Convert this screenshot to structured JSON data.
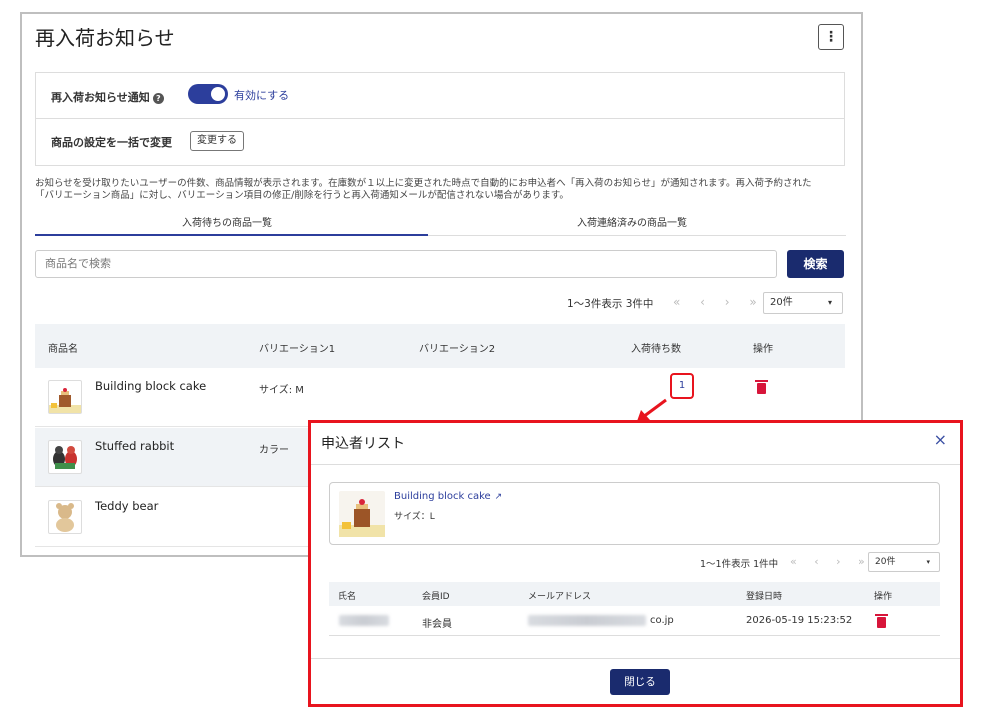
{
  "page": {
    "title": "再入荷お知らせ",
    "menu_icon": "⋮"
  },
  "settings": {
    "notify_label": "再入荷お知らせ通知",
    "help_icon": "?",
    "toggle_label": "有効にする",
    "toggle_on": true,
    "bulk_label": "商品の設定を一括で変更",
    "change_button": "変更する"
  },
  "description": {
    "line1": "お知らせを受け取りたいユーザーの件数、商品情報が表示されます。在庫数が１以上に変更された時点で自動的にお申込者へ「再入荷のお知らせ」が通知されます。再入荷予約された",
    "line2": "「バリエーション商品」に対し、バリエーション項目の修正/削除を行うと再入荷通知メールが配信されない場合があります。"
  },
  "tabs": [
    {
      "label": "入荷待ちの商品一覧",
      "active": true
    },
    {
      "label": "入荷連絡済みの商品一覧",
      "active": false
    }
  ],
  "search": {
    "placeholder": "商品名で検索",
    "button": "検索"
  },
  "pager": {
    "info": "1〜3件表示 3件中",
    "nav": "« ‹ › »",
    "per_page": "20件",
    "caret": "▾"
  },
  "table": {
    "headers": [
      "商品名",
      "バリエーション1",
      "バリエーション2",
      "入荷待ち数",
      "操作"
    ],
    "rows": [
      {
        "name": "Building block cake",
        "variation1": "サイズ: M",
        "variation2": "",
        "waiting": "1"
      },
      {
        "name": "Stuffed rabbit",
        "variation1": "カラー",
        "variation2": "",
        "waiting": ""
      },
      {
        "name": "Teddy bear",
        "variation1": "",
        "variation2": "",
        "waiting": ""
      }
    ]
  },
  "modal": {
    "title": "申込者リスト",
    "close_icon": "×",
    "product": {
      "name": "Building block cake",
      "external_icon": "↗",
      "variation": "サイズ：L"
    },
    "pager": {
      "info": "1〜1件表示 1件中",
      "nav": "« ‹ › »",
      "per_page": "20件",
      "caret": "▾"
    },
    "headers": [
      "氏名",
      "会員ID",
      "メールアドレス",
      "登録日時",
      "操作"
    ],
    "rows": [
      {
        "member_id": "非会員",
        "email_suffix": "co.jp",
        "registered_at": "2026-05-19 15:23:52"
      }
    ],
    "close_button": "閉じる"
  },
  "colors": {
    "primary": "#1a2b6e",
    "accent": "#2c3e9c",
    "danger": "#d7153a",
    "highlight": "#e8141e"
  }
}
